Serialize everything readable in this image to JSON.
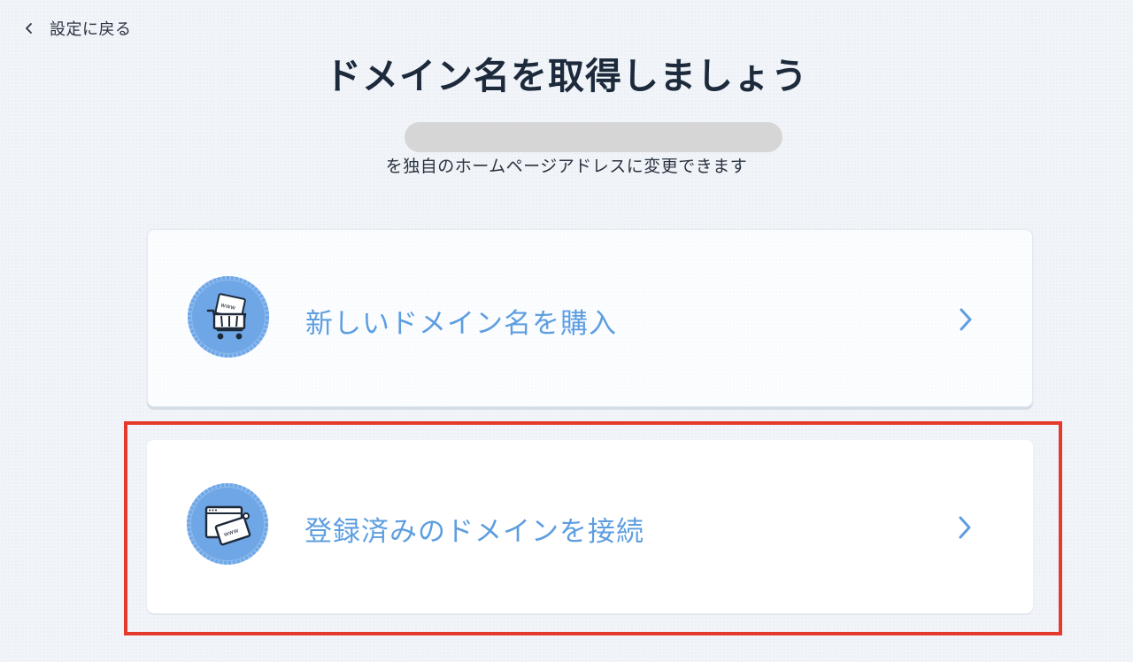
{
  "back_link": {
    "label": "設定に戻る",
    "icon": "chevron-left-icon"
  },
  "title": "ドメイン名を取得しましょう",
  "subtitle": "を独自のホームページアドレスに変更できます",
  "site_name": "",
  "options": [
    {
      "label": "新しいドメイン名を購入",
      "icon": "shopping-cart-www-icon"
    },
    {
      "label": "登録済みのドメインを接続",
      "icon": "browser-www-link-icon"
    }
  ],
  "colors": {
    "accent": "#5e9ee0",
    "badge_fill": "#6ea6e6",
    "highlight": "#e53a2b",
    "background": "#f1f4f8"
  }
}
